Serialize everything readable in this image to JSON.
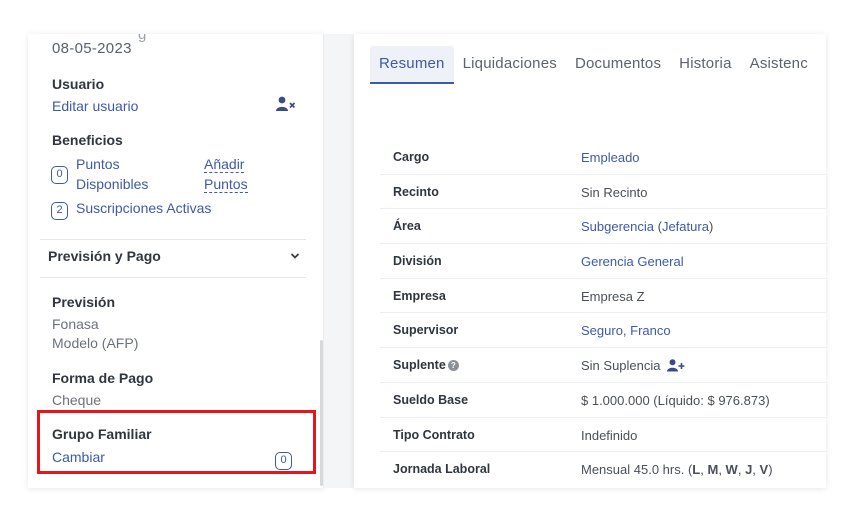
{
  "left": {
    "date": "08-05-2023",
    "usuario": {
      "title": "Usuario",
      "edit_link": "Editar usuario",
      "icon": "user-remove-icon"
    },
    "beneficios": {
      "title": "Beneficios",
      "puntos_count": "0",
      "puntos_line1": "Puntos",
      "puntos_line2": "Disponibles",
      "anadir_line1": "Añadir",
      "anadir_line2": "Puntos",
      "subs_count": "2",
      "subs_label": "Suscripciones Activas"
    },
    "prevision_pago": {
      "header": "Previsión y Pago"
    },
    "prevision": {
      "title": "Previsión",
      "line1": "Fonasa",
      "line2": "Modelo (AFP)"
    },
    "forma_pago": {
      "title": "Forma de Pago",
      "value": "Cheque"
    },
    "grupo_familiar": {
      "title": "Grupo Familiar",
      "link": "Cambiar",
      "count": "0"
    }
  },
  "tabs": [
    "Resumen",
    "Liquidaciones",
    "Documentos",
    "Historia",
    "Asistenc"
  ],
  "active_tab": "Resumen",
  "rows": [
    {
      "label": "Cargo",
      "value": "Empleado"
    },
    {
      "label": "Recinto",
      "value": "Sin Recinto"
    },
    {
      "label": "Área",
      "value_blue": "Subgerencia",
      "value_suffix_open": " (",
      "value_blue2": "Jefatura",
      "value_suffix_close": ")"
    },
    {
      "label": "División",
      "value": "Gerencia General"
    },
    {
      "label": "Empresa",
      "value": "Empresa Z"
    },
    {
      "label": "Supervisor",
      "value": "Seguro, Franco"
    },
    {
      "label": "Suplente",
      "value": "Sin Suplencia"
    },
    {
      "label": "Sueldo Base",
      "value": "$ 1.000.000 (Líquido: $ 976.873)"
    },
    {
      "label": "Tipo Contrato",
      "value": "Indefinido"
    },
    {
      "label": "Jornada Laboral",
      "value_prefix": "Mensual 45.0 hrs. (",
      "days": [
        "L",
        "M",
        "W",
        "J",
        "V"
      ],
      "value_close": ")"
    }
  ],
  "colors": {
    "accent": "#3d5aa6",
    "highlight": "#e8141b"
  }
}
